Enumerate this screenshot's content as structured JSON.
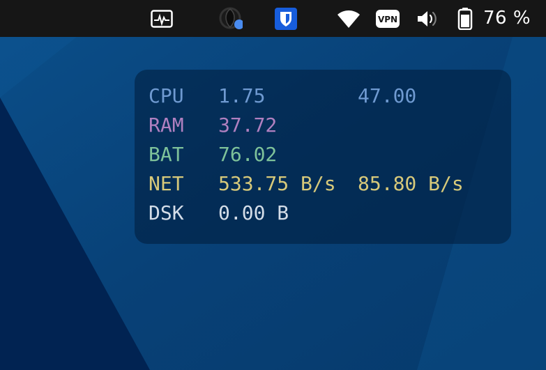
{
  "panel": {
    "icons": {
      "system_monitor": "system-monitor-icon",
      "app_indicator": "app-indicator-icon",
      "bitwarden": "bitwarden-shield-icon",
      "wifi": "wifi-icon",
      "vpn": "vpn-icon",
      "volume": "volume-icon",
      "battery": "battery-icon"
    },
    "vpn_label": "VPN",
    "battery_text": "76 %"
  },
  "monitor": {
    "rows": [
      {
        "label": "CPU",
        "value1": "1.75",
        "value2": "47.00"
      },
      {
        "label": "RAM",
        "value1": "37.72",
        "value2": ""
      },
      {
        "label": "BAT",
        "value1": "76.02",
        "value2": ""
      },
      {
        "label": "NET",
        "value1": "533.75 B/s",
        "value2": "85.80 B/s"
      },
      {
        "label": "DSK",
        "value1": "0.00 B",
        "value2": ""
      }
    ]
  },
  "colors": {
    "panel_bg": "#161616",
    "wallpaper_blue": "#0a4275",
    "wallpaper_dark": "#012352",
    "cpu": "#6f9ad1",
    "ram": "#b080c0",
    "bat": "#7ec29a",
    "net": "#d7c97a",
    "dsk": "#d4dde8",
    "bitwarden": "#175ddc",
    "indicator_dot": "#4a8cf0"
  }
}
